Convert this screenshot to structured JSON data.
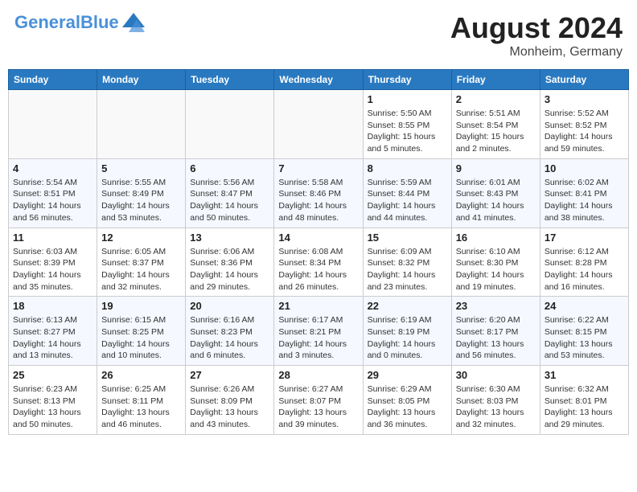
{
  "header": {
    "logo_general": "General",
    "logo_blue": "Blue",
    "month_year": "August 2024",
    "location": "Monheim, Germany"
  },
  "days_of_week": [
    "Sunday",
    "Monday",
    "Tuesday",
    "Wednesday",
    "Thursday",
    "Friday",
    "Saturday"
  ],
  "weeks": [
    {
      "days": [
        {
          "date": "",
          "info": ""
        },
        {
          "date": "",
          "info": ""
        },
        {
          "date": "",
          "info": ""
        },
        {
          "date": "",
          "info": ""
        },
        {
          "date": "1",
          "info": "Sunrise: 5:50 AM\nSunset: 8:55 PM\nDaylight: 15 hours\nand 5 minutes."
        },
        {
          "date": "2",
          "info": "Sunrise: 5:51 AM\nSunset: 8:54 PM\nDaylight: 15 hours\nand 2 minutes."
        },
        {
          "date": "3",
          "info": "Sunrise: 5:52 AM\nSunset: 8:52 PM\nDaylight: 14 hours\nand 59 minutes."
        }
      ]
    },
    {
      "days": [
        {
          "date": "4",
          "info": "Sunrise: 5:54 AM\nSunset: 8:51 PM\nDaylight: 14 hours\nand 56 minutes."
        },
        {
          "date": "5",
          "info": "Sunrise: 5:55 AM\nSunset: 8:49 PM\nDaylight: 14 hours\nand 53 minutes."
        },
        {
          "date": "6",
          "info": "Sunrise: 5:56 AM\nSunset: 8:47 PM\nDaylight: 14 hours\nand 50 minutes."
        },
        {
          "date": "7",
          "info": "Sunrise: 5:58 AM\nSunset: 8:46 PM\nDaylight: 14 hours\nand 48 minutes."
        },
        {
          "date": "8",
          "info": "Sunrise: 5:59 AM\nSunset: 8:44 PM\nDaylight: 14 hours\nand 44 minutes."
        },
        {
          "date": "9",
          "info": "Sunrise: 6:01 AM\nSunset: 8:43 PM\nDaylight: 14 hours\nand 41 minutes."
        },
        {
          "date": "10",
          "info": "Sunrise: 6:02 AM\nSunset: 8:41 PM\nDaylight: 14 hours\nand 38 minutes."
        }
      ]
    },
    {
      "days": [
        {
          "date": "11",
          "info": "Sunrise: 6:03 AM\nSunset: 8:39 PM\nDaylight: 14 hours\nand 35 minutes."
        },
        {
          "date": "12",
          "info": "Sunrise: 6:05 AM\nSunset: 8:37 PM\nDaylight: 14 hours\nand 32 minutes."
        },
        {
          "date": "13",
          "info": "Sunrise: 6:06 AM\nSunset: 8:36 PM\nDaylight: 14 hours\nand 29 minutes."
        },
        {
          "date": "14",
          "info": "Sunrise: 6:08 AM\nSunset: 8:34 PM\nDaylight: 14 hours\nand 26 minutes."
        },
        {
          "date": "15",
          "info": "Sunrise: 6:09 AM\nSunset: 8:32 PM\nDaylight: 14 hours\nand 23 minutes."
        },
        {
          "date": "16",
          "info": "Sunrise: 6:10 AM\nSunset: 8:30 PM\nDaylight: 14 hours\nand 19 minutes."
        },
        {
          "date": "17",
          "info": "Sunrise: 6:12 AM\nSunset: 8:28 PM\nDaylight: 14 hours\nand 16 minutes."
        }
      ]
    },
    {
      "days": [
        {
          "date": "18",
          "info": "Sunrise: 6:13 AM\nSunset: 8:27 PM\nDaylight: 14 hours\nand 13 minutes."
        },
        {
          "date": "19",
          "info": "Sunrise: 6:15 AM\nSunset: 8:25 PM\nDaylight: 14 hours\nand 10 minutes."
        },
        {
          "date": "20",
          "info": "Sunrise: 6:16 AM\nSunset: 8:23 PM\nDaylight: 14 hours\nand 6 minutes."
        },
        {
          "date": "21",
          "info": "Sunrise: 6:17 AM\nSunset: 8:21 PM\nDaylight: 14 hours\nand 3 minutes."
        },
        {
          "date": "22",
          "info": "Sunrise: 6:19 AM\nSunset: 8:19 PM\nDaylight: 14 hours\nand 0 minutes."
        },
        {
          "date": "23",
          "info": "Sunrise: 6:20 AM\nSunset: 8:17 PM\nDaylight: 13 hours\nand 56 minutes."
        },
        {
          "date": "24",
          "info": "Sunrise: 6:22 AM\nSunset: 8:15 PM\nDaylight: 13 hours\nand 53 minutes."
        }
      ]
    },
    {
      "days": [
        {
          "date": "25",
          "info": "Sunrise: 6:23 AM\nSunset: 8:13 PM\nDaylight: 13 hours\nand 50 minutes."
        },
        {
          "date": "26",
          "info": "Sunrise: 6:25 AM\nSunset: 8:11 PM\nDaylight: 13 hours\nand 46 minutes."
        },
        {
          "date": "27",
          "info": "Sunrise: 6:26 AM\nSunset: 8:09 PM\nDaylight: 13 hours\nand 43 minutes."
        },
        {
          "date": "28",
          "info": "Sunrise: 6:27 AM\nSunset: 8:07 PM\nDaylight: 13 hours\nand 39 minutes."
        },
        {
          "date": "29",
          "info": "Sunrise: 6:29 AM\nSunset: 8:05 PM\nDaylight: 13 hours\nand 36 minutes."
        },
        {
          "date": "30",
          "info": "Sunrise: 6:30 AM\nSunset: 8:03 PM\nDaylight: 13 hours\nand 32 minutes."
        },
        {
          "date": "31",
          "info": "Sunrise: 6:32 AM\nSunset: 8:01 PM\nDaylight: 13 hours\nand 29 minutes."
        }
      ]
    }
  ]
}
